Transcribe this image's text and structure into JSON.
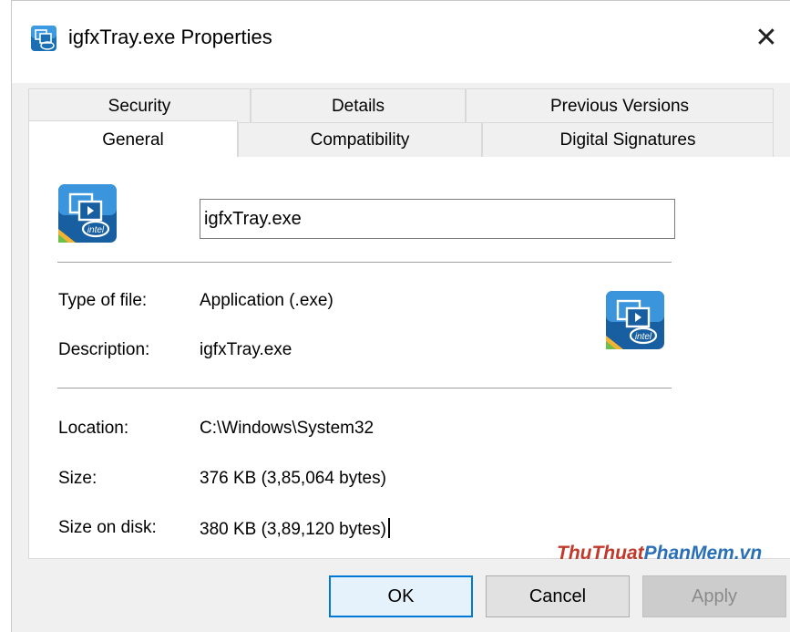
{
  "window": {
    "title": "igfxTray.exe Properties",
    "close_glyph": "✕",
    "app_icon": "intel-graphics-icon"
  },
  "tabs": {
    "top_row": [
      {
        "label": "Security"
      },
      {
        "label": "Details"
      },
      {
        "label": "Previous Versions"
      }
    ],
    "bottom_row": [
      {
        "label": "General",
        "active": true
      },
      {
        "label": "Compatibility"
      },
      {
        "label": "Digital Signatures"
      }
    ]
  },
  "general": {
    "file_name": "igfxTray.exe",
    "type_of_file_label": "Type of file:",
    "type_of_file_value": "Application (.exe)",
    "description_label": "Description:",
    "description_value": "igfxTray.exe",
    "location_label": "Location:",
    "location_value": "C:\\Windows\\System32",
    "size_label": "Size:",
    "size_value": "376 KB (3,85,064 bytes)",
    "size_on_disk_label": "Size on disk:",
    "size_on_disk_value": "380 KB (3,89,120 bytes)"
  },
  "buttons": {
    "ok": "OK",
    "cancel": "Cancel",
    "apply": "Apply"
  },
  "watermark": {
    "part1": "ThuThuat",
    "part2": "PhanMem.vn"
  },
  "colors": {
    "accent": "#0078d7",
    "watermark_red": "#c0392b",
    "watermark_blue": "#2a6fb8"
  }
}
